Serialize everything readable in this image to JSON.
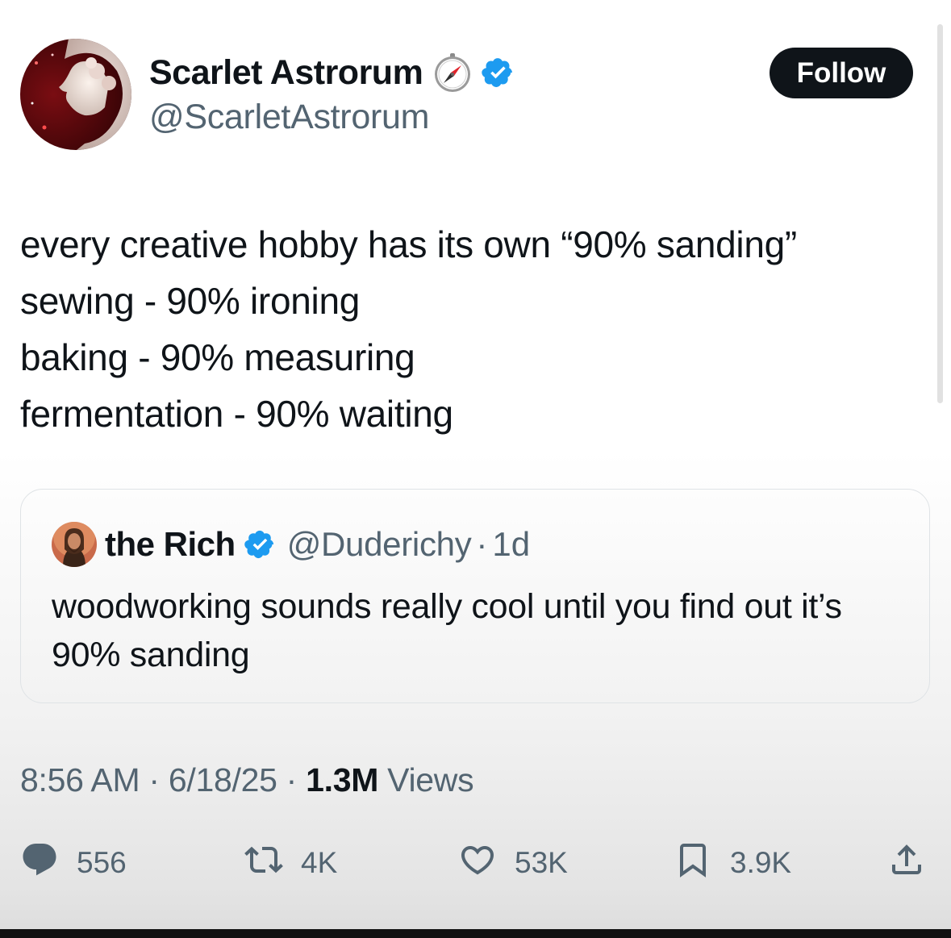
{
  "author": {
    "name": "Scarlet Astrorum",
    "handle": "@ScarletAstrorum",
    "follow_label": "Follow"
  },
  "tweet": {
    "lines": [
      "every creative hobby has its own “90% sanding”",
      "sewing - 90% ironing",
      "baking - 90% measuring",
      "fermentation - 90% waiting"
    ]
  },
  "quote": {
    "name": "the Rich",
    "handle": "@Duderichy",
    "separator": "·",
    "time": "1d",
    "text": "woodworking sounds really cool until you find out it’s 90% sanding"
  },
  "meta": {
    "time": "8:56 AM",
    "date": "6/18/25",
    "views_count": "1.3M",
    "views_label": "Views",
    "separator": "·"
  },
  "actions": {
    "replies": "556",
    "reposts": "4K",
    "likes": "53K",
    "bookmarks": "3.9K"
  },
  "colors": {
    "verified": "#1d9bf0",
    "text_primary": "#0f1419",
    "text_secondary": "#536471",
    "follow_bg": "#0f1419"
  }
}
